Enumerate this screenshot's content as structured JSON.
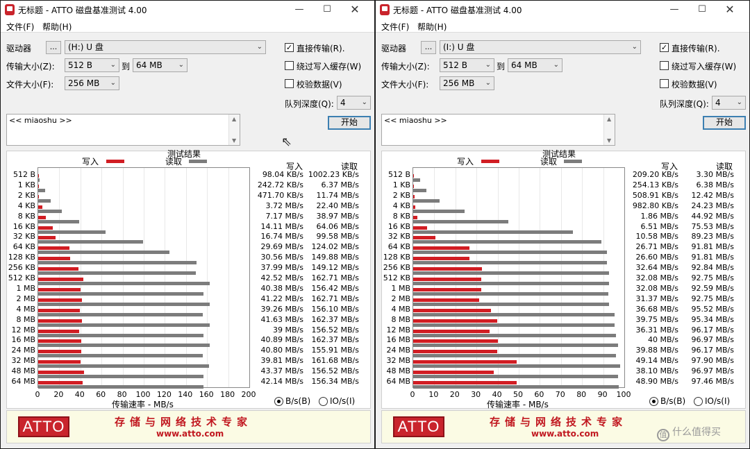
{
  "windows": [
    {
      "title": "无标题 - ATTO 磁盘基准测试 4.00",
      "title_buttons": {
        "minimize": "—",
        "maximize": "☐",
        "close": "✕"
      },
      "menu": {
        "file": "文件(F)",
        "help": "帮助(H)"
      },
      "drive_label": "驱动器",
      "browse_button": "...",
      "drive_value": "(H:) U 盘",
      "transfer_size_label": "传输大小(Z):",
      "transfer_from": "512 B",
      "to_label": "到",
      "transfer_to": "64 MB",
      "file_size_label": "文件大小(F):",
      "file_size": "256 MB",
      "direct_io_label": "直接传输(R).",
      "direct_io_checked": true,
      "bypass_cache_label": "绕过写入缓存(W)",
      "bypass_cache_checked": false,
      "verify_label": "校验数据(V)",
      "verify_checked": false,
      "queue_depth_label": "队列深度(Q):",
      "queue_depth": "4",
      "start_button": "开始",
      "description": "<< miaoshu >>",
      "results_title": "测试结果",
      "legend_write": "写入",
      "legend_read": "读取",
      "col_write": "写入",
      "col_read": "读取",
      "x_axis_title": "传输速率 - MB/s",
      "radio_bs": "B/s(B)",
      "radio_io": "IO/s(I)",
      "radio_selected": "bs",
      "banner": {
        "logo": "ATTO",
        "slogan": "存储与网络技术专家",
        "site": "www.atto.com"
      },
      "chart_data": {
        "type": "bar",
        "orientation": "horizontal",
        "xlim": [
          0,
          200
        ],
        "xticks": [
          "0",
          "20",
          "40",
          "60",
          "80",
          "100",
          "120",
          "140",
          "160",
          "180",
          "200"
        ],
        "categories": [
          "512 B",
          "1 KB",
          "2 KB",
          "4 KB",
          "8 KB",
          "16 KB",
          "32 KB",
          "64 KB",
          "128 KB",
          "256 KB",
          "512 KB",
          "1 MB",
          "2 MB",
          "4 MB",
          "8 MB",
          "12 MB",
          "16 MB",
          "24 MB",
          "32 MB",
          "48 MB",
          "64 MB"
        ],
        "series": [
          {
            "name": "写入",
            "color": "#d11d23",
            "values": [
              0.098,
              0.243,
              0.472,
              3.72,
              7.17,
              14.11,
              16.74,
              29.69,
              30.56,
              37.99,
              42.52,
              40.38,
              41.22,
              39.26,
              41.63,
              39,
              40.89,
              40.8,
              39.81,
              43.37,
              42.14
            ],
            "labels": [
              "98.04 KB/s",
              "242.72 KB/s",
              "471.70 KB/s",
              "3.72 MB/s",
              "7.17 MB/s",
              "14.11 MB/s",
              "16.74 MB/s",
              "29.69 MB/s",
              "30.56 MB/s",
              "37.99 MB/s",
              "42.52 MB/s",
              "40.38 MB/s",
              "41.22 MB/s",
              "39.26 MB/s",
              "41.63 MB/s",
              "39 MB/s",
              "40.89 MB/s",
              "40.80 MB/s",
              "39.81 MB/s",
              "43.37 MB/s",
              "42.14 MB/s"
            ]
          },
          {
            "name": "读取",
            "color": "#7c7c7c",
            "values": [
              1.002,
              6.37,
              11.74,
              22.4,
              38.97,
              64.06,
              99.58,
              124.02,
              149.88,
              149.12,
              162.71,
              156.42,
              162.71,
              156.1,
              162.37,
              156.52,
              162.37,
              155.91,
              161.68,
              156.52,
              156.34
            ],
            "labels": [
              "1002.23 KB/s",
              "6.37 MB/s",
              "11.74 MB/s",
              "22.40 MB/s",
              "38.97 MB/s",
              "64.06 MB/s",
              "99.58 MB/s",
              "124.02 MB/s",
              "149.88 MB/s",
              "149.12 MB/s",
              "162.71 MB/s",
              "156.42 MB/s",
              "162.71 MB/s",
              "156.10 MB/s",
              "162.37 MB/s",
              "156.52 MB/s",
              "162.37 MB/s",
              "155.91 MB/s",
              "161.68 MB/s",
              "156.52 MB/s",
              "156.34 MB/s"
            ]
          }
        ]
      }
    },
    {
      "title": "无标题 - ATTO 磁盘基准测试 4.00",
      "title_buttons": {
        "minimize": "—",
        "maximize": "☐",
        "close": "✕"
      },
      "menu": {
        "file": "文件(F)",
        "help": "帮助(H)"
      },
      "drive_label": "驱动器",
      "browse_button": "...",
      "drive_value": "(I:) U 盘",
      "transfer_size_label": "传输大小(Z):",
      "transfer_from": "512 B",
      "to_label": "到",
      "transfer_to": "64 MB",
      "file_size_label": "文件大小(F):",
      "file_size": "256 MB",
      "direct_io_label": "直接传输(R).",
      "direct_io_checked": true,
      "bypass_cache_label": "绕过写入缓存(W)",
      "bypass_cache_checked": false,
      "verify_label": "校验数据(V)",
      "verify_checked": false,
      "queue_depth_label": "队列深度(Q):",
      "queue_depth": "4",
      "start_button": "开始",
      "description": "<< miaoshu >>",
      "results_title": "测试结果",
      "legend_write": "写入",
      "legend_read": "读取",
      "col_write": "写入",
      "col_read": "读取",
      "x_axis_title": "传输速率 - MB/s",
      "radio_bs": "B/s(B)",
      "radio_io": "IO/s(I)",
      "radio_selected": "bs",
      "banner": {
        "logo": "ATTO",
        "slogan": "存储与网络技术专家",
        "site": "www.atto.com"
      },
      "chart_data": {
        "type": "bar",
        "orientation": "horizontal",
        "xlim": [
          0,
          100
        ],
        "xticks": [
          "0",
          "10",
          "20",
          "30",
          "40",
          "50",
          "60",
          "70",
          "80",
          "90",
          "100"
        ],
        "categories": [
          "512 B",
          "1 KB",
          "2 KB",
          "4 KB",
          "8 KB",
          "16 KB",
          "32 KB",
          "64 KB",
          "128 KB",
          "256 KB",
          "512 KB",
          "1 MB",
          "2 MB",
          "4 MB",
          "8 MB",
          "12 MB",
          "16 MB",
          "24 MB",
          "32 MB",
          "48 MB",
          "64 MB"
        ],
        "series": [
          {
            "name": "写入",
            "color": "#d11d23",
            "values": [
              0.209,
              0.254,
              0.509,
              0.983,
              1.86,
              6.51,
              10.58,
              26.71,
              26.6,
              32.64,
              32.08,
              32.08,
              31.37,
              36.68,
              39.75,
              36.31,
              40,
              39.88,
              49.14,
              38.1,
              48.9
            ],
            "labels": [
              "209.20 KB/s",
              "254.13 KB/s",
              "508.91 KB/s",
              "982.80 KB/s",
              "1.86 MB/s",
              "6.51 MB/s",
              "10.58 MB/s",
              "26.71 MB/s",
              "26.60 MB/s",
              "32.64 MB/s",
              "32.08 MB/s",
              "32.08 MB/s",
              "31.37 MB/s",
              "36.68 MB/s",
              "39.75 MB/s",
              "36.31 MB/s",
              "40 MB/s",
              "39.88 MB/s",
              "49.14 MB/s",
              "38.10 MB/s",
              "48.90 MB/s"
            ]
          },
          {
            "name": "读取",
            "color": "#7c7c7c",
            "values": [
              3.3,
              6.38,
              12.42,
              24.23,
              44.92,
              75.53,
              89.23,
              91.81,
              91.81,
              92.84,
              92.75,
              92.59,
              92.75,
              95.52,
              95.34,
              96.17,
              96.97,
              96.17,
              97.9,
              96.97,
              97.46
            ],
            "labels": [
              "3.30 MB/s",
              "6.38 MB/s",
              "12.42 MB/s",
              "24.23 MB/s",
              "44.92 MB/s",
              "75.53 MB/s",
              "89.23 MB/s",
              "91.81 MB/s",
              "91.81 MB/s",
              "92.84 MB/s",
              "92.75 MB/s",
              "92.59 MB/s",
              "92.75 MB/s",
              "95.52 MB/s",
              "95.34 MB/s",
              "96.17 MB/s",
              "96.97 MB/s",
              "96.17 MB/s",
              "97.90 MB/s",
              "96.97 MB/s",
              "97.46 MB/s"
            ]
          }
        ]
      }
    }
  ],
  "cursor_icon": "arrow-cursor",
  "watermark": {
    "icon": "值",
    "text": "什么值得买"
  }
}
